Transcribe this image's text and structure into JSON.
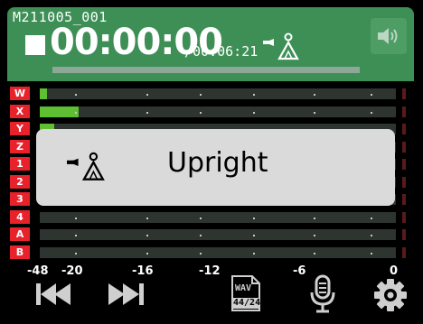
{
  "header": {
    "file_name": "M211005_001",
    "timecode": "00:00:00",
    "total_time": "/00:06:21",
    "progress": 0.0,
    "accent_color": "#3d8f56",
    "speaker_icon": "speaker-icon"
  },
  "meters": {
    "channels": [
      {
        "label": "W",
        "level": 0.02
      },
      {
        "label": "X",
        "level": 0.11
      },
      {
        "label": "Y",
        "level": 0.04
      },
      {
        "label": "Z",
        "level": 0.03
      },
      {
        "label": "1",
        "level": 0.0
      },
      {
        "label": "2",
        "level": 0.0
      },
      {
        "label": "3",
        "level": 0.0
      },
      {
        "label": "4",
        "level": 0.0
      },
      {
        "label": "A",
        "level": 0.0
      },
      {
        "label": "B",
        "level": 0.0
      }
    ],
    "scale": [
      "-48",
      "-20",
      "-16",
      "-12",
      "-6",
      "0"
    ],
    "level_color": "#5fbf32",
    "label_color": "#e8222b"
  },
  "overlay": {
    "text": "Upright",
    "icon": "scene-upright-icon"
  },
  "controls": {
    "rewind_icon": "rewind-icon",
    "forward_icon": "fast-forward-icon",
    "format_line1": "WAV",
    "format_line2": "44/24",
    "mic_icon": "microphone-icon",
    "settings_icon": "gear-icon"
  }
}
